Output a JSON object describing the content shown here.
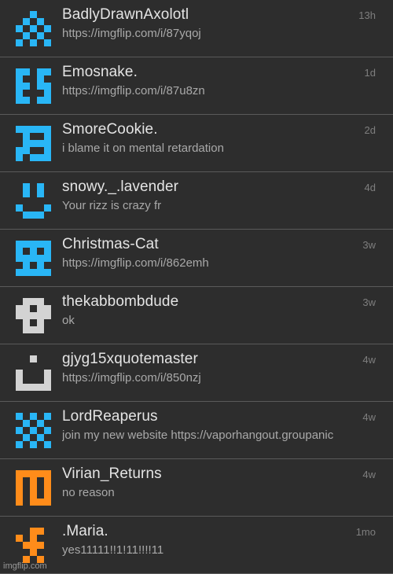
{
  "conversations": [
    {
      "username": "BadlyDrawnAxolotl",
      "preview": "https://imgflip.com/i/87yqoj",
      "time": "13h",
      "avatar_icon": "pixel-avatar-dots-icon",
      "avatar_color": "#29b6f6"
    },
    {
      "username": "Emosnake.",
      "preview": "https://imgflip.com/i/87u8zn",
      "time": "1d",
      "avatar_icon": "pixel-avatar-es-icon",
      "avatar_color": "#29b6f6"
    },
    {
      "username": "SmoreCookie.",
      "preview": "i blame it on mental retardation",
      "time": "2d",
      "avatar_icon": "pixel-avatar-swirl-icon",
      "avatar_color": "#29b6f6"
    },
    {
      "username": "snowy._.lavender",
      "preview": "Your rizz is crazy fr",
      "time": "4d",
      "avatar_icon": "pixel-avatar-smile-icon",
      "avatar_color": "#29b6f6"
    },
    {
      "username": "Christmas-Cat",
      "preview": "https://imgflip.com/i/862emh",
      "time": "3w",
      "avatar_icon": "pixel-avatar-invader-icon",
      "avatar_color": "#29b6f6"
    },
    {
      "username": "thekabbombdude",
      "preview": "ok",
      "time": "3w",
      "avatar_icon": "pixel-avatar-skull-icon",
      "avatar_color": "#d3d3d3"
    },
    {
      "username": "gjyg15xquotemaster",
      "preview": "https://imgflip.com/i/850nzj",
      "time": "4w",
      "avatar_icon": "pixel-avatar-grin-icon",
      "avatar_color": "#d3d3d3"
    },
    {
      "username": "LordReaperus",
      "preview": "join my new website https://vaporhangout.groupanic",
      "time": "4w",
      "avatar_icon": "pixel-avatar-checker-icon",
      "avatar_color": "#29b6f6"
    },
    {
      "username": "Virian_Returns",
      "preview": "no reason",
      "time": "4w",
      "avatar_icon": "pixel-avatar-wave-icon",
      "avatar_color": "#ff8c1a"
    },
    {
      "username": ".Maria.",
      "preview": "yes11111!!1!11!!!!11",
      "time": "1mo",
      "avatar_icon": "pixel-avatar-cross-icon",
      "avatar_color": "#ff8c1a"
    }
  ],
  "watermark": "imgflip.com"
}
